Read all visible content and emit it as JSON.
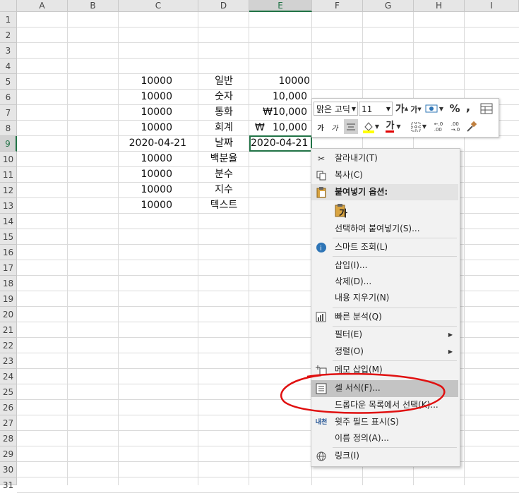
{
  "columns": [
    "A",
    "B",
    "C",
    "D",
    "E",
    "F",
    "G",
    "H",
    "I"
  ],
  "selected_column": "E",
  "rows": [
    "1",
    "2",
    "3",
    "4",
    "5",
    "6",
    "7",
    "8",
    "9",
    "10",
    "11",
    "12",
    "13",
    "14",
    "15",
    "16",
    "17",
    "18",
    "19",
    "20",
    "21",
    "22",
    "23",
    "24",
    "25",
    "26",
    "27",
    "28",
    "29",
    "30",
    "31"
  ],
  "selected_row": "9",
  "cells": {
    "c5": "10000",
    "d5": "일반",
    "e5": "10000",
    "c6": "10000",
    "d6": "숫자",
    "e6": "10,000",
    "c7": "10000",
    "d7": "통화",
    "e7": "₩10,000",
    "c8": "10000",
    "d8": "회계",
    "e8_symbol": "₩",
    "e8_value": "10,000",
    "c9": "2020-04-21",
    "d9": "날짜",
    "e9": "2020-04-21",
    "c10": "10000",
    "d10": "백분율",
    "c11": "10000",
    "d11": "분수",
    "c12": "10000",
    "d12": "지수",
    "c13": "10000",
    "d13": "텍스트"
  },
  "mini_toolbar": {
    "font_name": "맑은 고딕",
    "font_size": "11",
    "grow_font": "가",
    "shrink_font": "가",
    "percent": "%",
    "comma": ",",
    "bold": "가",
    "italic": "가",
    "font_color_letter": "가",
    "inc_decimal": "←.0\n.00",
    "dec_decimal": ".00\n→.0"
  },
  "context_menu": {
    "cut": "잘라내기(T)",
    "copy": "복사(C)",
    "paste_options": "붙여넣기 옵션:",
    "paste_icon_letter": "가",
    "paste_special": "선택하여 붙여넣기(S)...",
    "smart_lookup": "스마트 조회(L)",
    "insert": "삽입(I)...",
    "delete": "삭제(D)...",
    "clear_contents": "내용 지우기(N)",
    "quick_analysis": "빠른 분석(Q)",
    "filter": "필터(E)",
    "sort": "정렬(O)",
    "insert_comment": "메모 삽입(M)",
    "format_cells": "셀 서식(F)...",
    "pick_dropdown": "드롭다운 목록에서 선택(K)...",
    "phonetic": "윗주 필드 표시(S)",
    "define_name": "이름 정의(A)...",
    "link": "링크(I)",
    "phonetic_icon_text": "내천"
  },
  "annotation_color": "#e01010",
  "accent_color": "#217346"
}
